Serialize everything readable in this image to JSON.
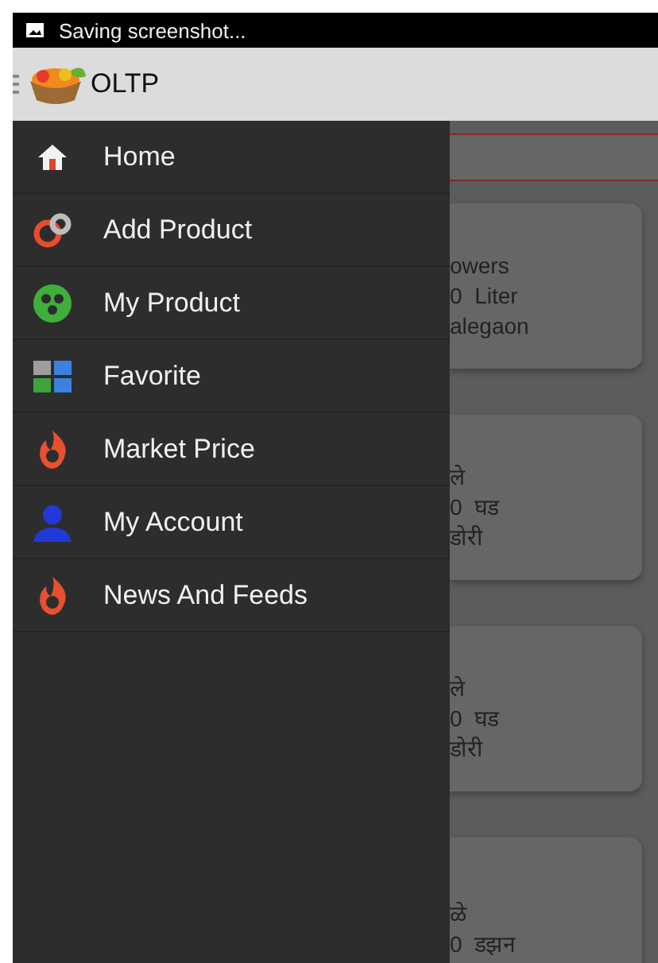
{
  "status_bar": {
    "notification": "Saving screenshot..."
  },
  "toolbar": {
    "title": "OLTP"
  },
  "drawer": {
    "items": [
      {
        "label": "Home",
        "kind": "home"
      },
      {
        "label": "Add Product",
        "kind": "add"
      },
      {
        "label": "My Product",
        "kind": "products"
      },
      {
        "label": "Favorite",
        "kind": "favorite"
      },
      {
        "label": "Market Price",
        "kind": "prices"
      },
      {
        "label": "My Account",
        "kind": "account"
      },
      {
        "label": "News And Feeds",
        "kind": "news"
      }
    ]
  },
  "cards": [
    {
      "lines": [
        "owers",
        "0  Liter",
        "alegaon"
      ]
    },
    {
      "lines": [
        "ले",
        "0  घड",
        "डोरी"
      ]
    },
    {
      "lines": [
        "ले",
        "0  घड",
        "डोरी"
      ]
    },
    {
      "lines": [
        "ळे",
        "0  डझन"
      ]
    }
  ]
}
